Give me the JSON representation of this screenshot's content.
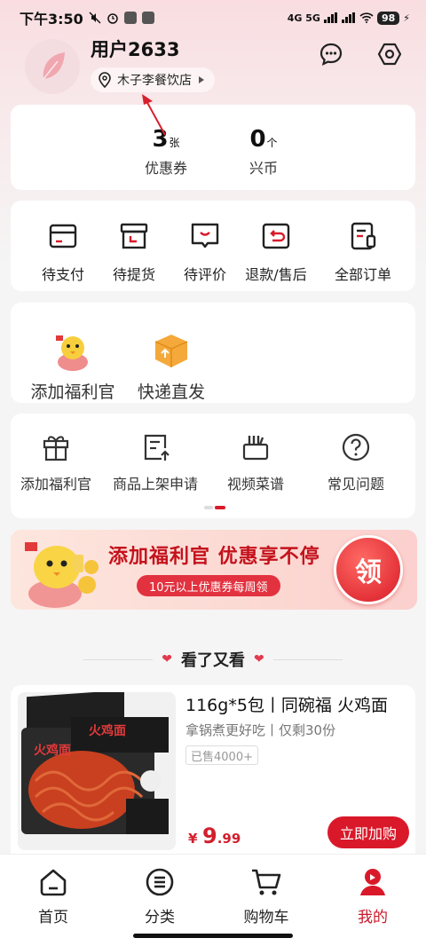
{
  "status_bar": {
    "time": "下午3:50",
    "network": "4G 5G",
    "battery": "98"
  },
  "profile": {
    "username": "用户2633",
    "store": "木子李餐饮店"
  },
  "stats": [
    {
      "num": "3",
      "unit": "张",
      "label": "优惠券"
    },
    {
      "num": "0",
      "unit": "个",
      "label": "兴币"
    }
  ],
  "orders": [
    "待支付",
    "待提货",
    "待评价",
    "退款/售后",
    "全部订单"
  ],
  "features": [
    "添加福利官",
    "快递直发"
  ],
  "services": [
    "添加福利官",
    "商品上架申请",
    "视频菜谱",
    "常见问题"
  ],
  "banner": {
    "title": "添加福利官 优惠享不停",
    "subtitle": "10元以上优惠券每周领",
    "claim": "领"
  },
  "section": {
    "title": "看了又看"
  },
  "product": {
    "title": "116g*5包丨同碗福 火鸡面",
    "subtitle": "拿锅煮更好吃丨仅剩30份",
    "sold": "已售4000+",
    "price_currency": "¥",
    "price_int": "9",
    "price_dec": ".99",
    "buy_label": "立即加购"
  },
  "tabs": [
    "首页",
    "分类",
    "购物车",
    "我的"
  ],
  "colors": {
    "accent": "#d9192a",
    "active_tab": "#c8182a"
  }
}
